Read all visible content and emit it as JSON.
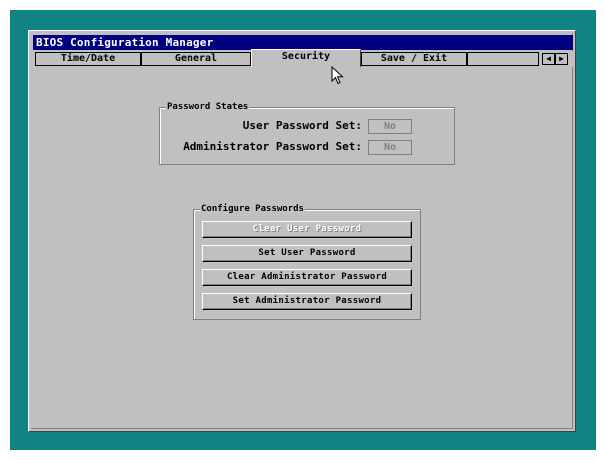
{
  "window": {
    "title": "BIOS Configuration Manager"
  },
  "tabs": [
    {
      "label": "Time/Date",
      "active": false
    },
    {
      "label": "General",
      "active": false
    },
    {
      "label": "Security",
      "active": true
    },
    {
      "label": "Save / Exit",
      "active": false
    }
  ],
  "tab_scroll": {
    "left_icon": "arrow-left-icon",
    "right_icon": "arrow-right-icon"
  },
  "password_states": {
    "heading": "Password States",
    "user_label": "User Password Set:",
    "user_value": "No",
    "admin_label": "Administrator Password Set:",
    "admin_value": "No"
  },
  "configure_passwords": {
    "heading": "Configure Passwords",
    "buttons": [
      {
        "label": "Clear User Password",
        "enabled": false
      },
      {
        "label": "Set User Password",
        "enabled": true
      },
      {
        "label": "Clear Administrator Password",
        "enabled": true
      },
      {
        "label": "Set Administrator Password",
        "enabled": true
      }
    ]
  },
  "colors": {
    "desktop": "#108484",
    "title_bar": "#000080",
    "panel": "#c0c0c0"
  }
}
